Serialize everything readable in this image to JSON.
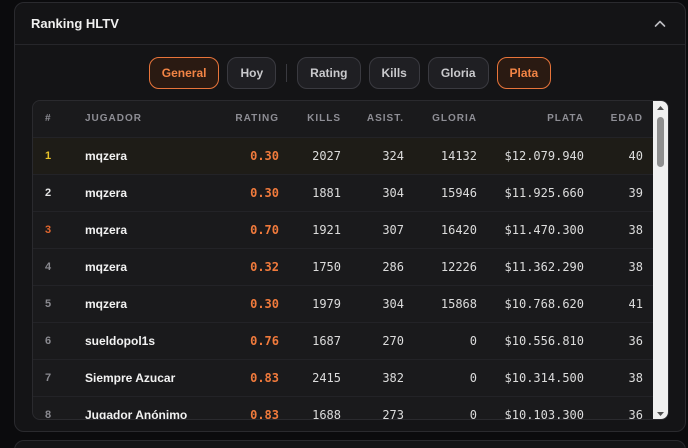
{
  "panel": {
    "title": "Ranking HLTV"
  },
  "filters": [
    {
      "label": "General",
      "active": true
    },
    {
      "label": "Hoy",
      "active": false
    },
    {
      "label": "Rating",
      "active": false
    },
    {
      "label": "Kills",
      "active": false
    },
    {
      "label": "Gloria",
      "active": false
    },
    {
      "label": "Plata",
      "active": true
    }
  ],
  "table": {
    "headers": {
      "rank": "#",
      "player": "JUGADOR",
      "rating": "RATING",
      "kills": "KILLS",
      "assists": "ASIST.",
      "glory": "GLORIA",
      "money": "PLATA",
      "age": "EDAD"
    },
    "rows": [
      {
        "rank": "1",
        "player": "mqzera",
        "rating": "0.30",
        "kills": "2027",
        "assists": "324",
        "glory": "14132",
        "money": "$12.079.940",
        "age": "40"
      },
      {
        "rank": "2",
        "player": "mqzera",
        "rating": "0.30",
        "kills": "1881",
        "assists": "304",
        "glory": "15946",
        "money": "$11.925.660",
        "age": "39"
      },
      {
        "rank": "3",
        "player": "mqzera",
        "rating": "0.70",
        "kills": "1921",
        "assists": "307",
        "glory": "16420",
        "money": "$11.470.300",
        "age": "38"
      },
      {
        "rank": "4",
        "player": "mqzera",
        "rating": "0.32",
        "kills": "1750",
        "assists": "286",
        "glory": "12226",
        "money": "$11.362.290",
        "age": "38"
      },
      {
        "rank": "5",
        "player": "mqzera",
        "rating": "0.30",
        "kills": "1979",
        "assists": "304",
        "glory": "15868",
        "money": "$10.768.620",
        "age": "41"
      },
      {
        "rank": "6",
        "player": "sueldopol1s",
        "rating": "0.76",
        "kills": "1687",
        "assists": "270",
        "glory": "0",
        "money": "$10.556.810",
        "age": "36"
      },
      {
        "rank": "7",
        "player": "Siempre Azucar",
        "rating": "0.83",
        "kills": "2415",
        "assists": "382",
        "glory": "0",
        "money": "$10.314.500",
        "age": "38"
      },
      {
        "rank": "8",
        "player": "Jugador Anónimo",
        "rating": "0.83",
        "kills": "1688",
        "assists": "273",
        "glory": "0",
        "money": "$10.103.300",
        "age": "36"
      }
    ]
  },
  "colors": {
    "accent": "#f07a3c",
    "gold": "#e8c22a",
    "bronze": "#e0662e",
    "background": "#141416"
  },
  "icons": {
    "collapse": "chevron-up-icon",
    "scroll_up": "triangle-up-icon",
    "scroll_down": "triangle-down-icon"
  }
}
